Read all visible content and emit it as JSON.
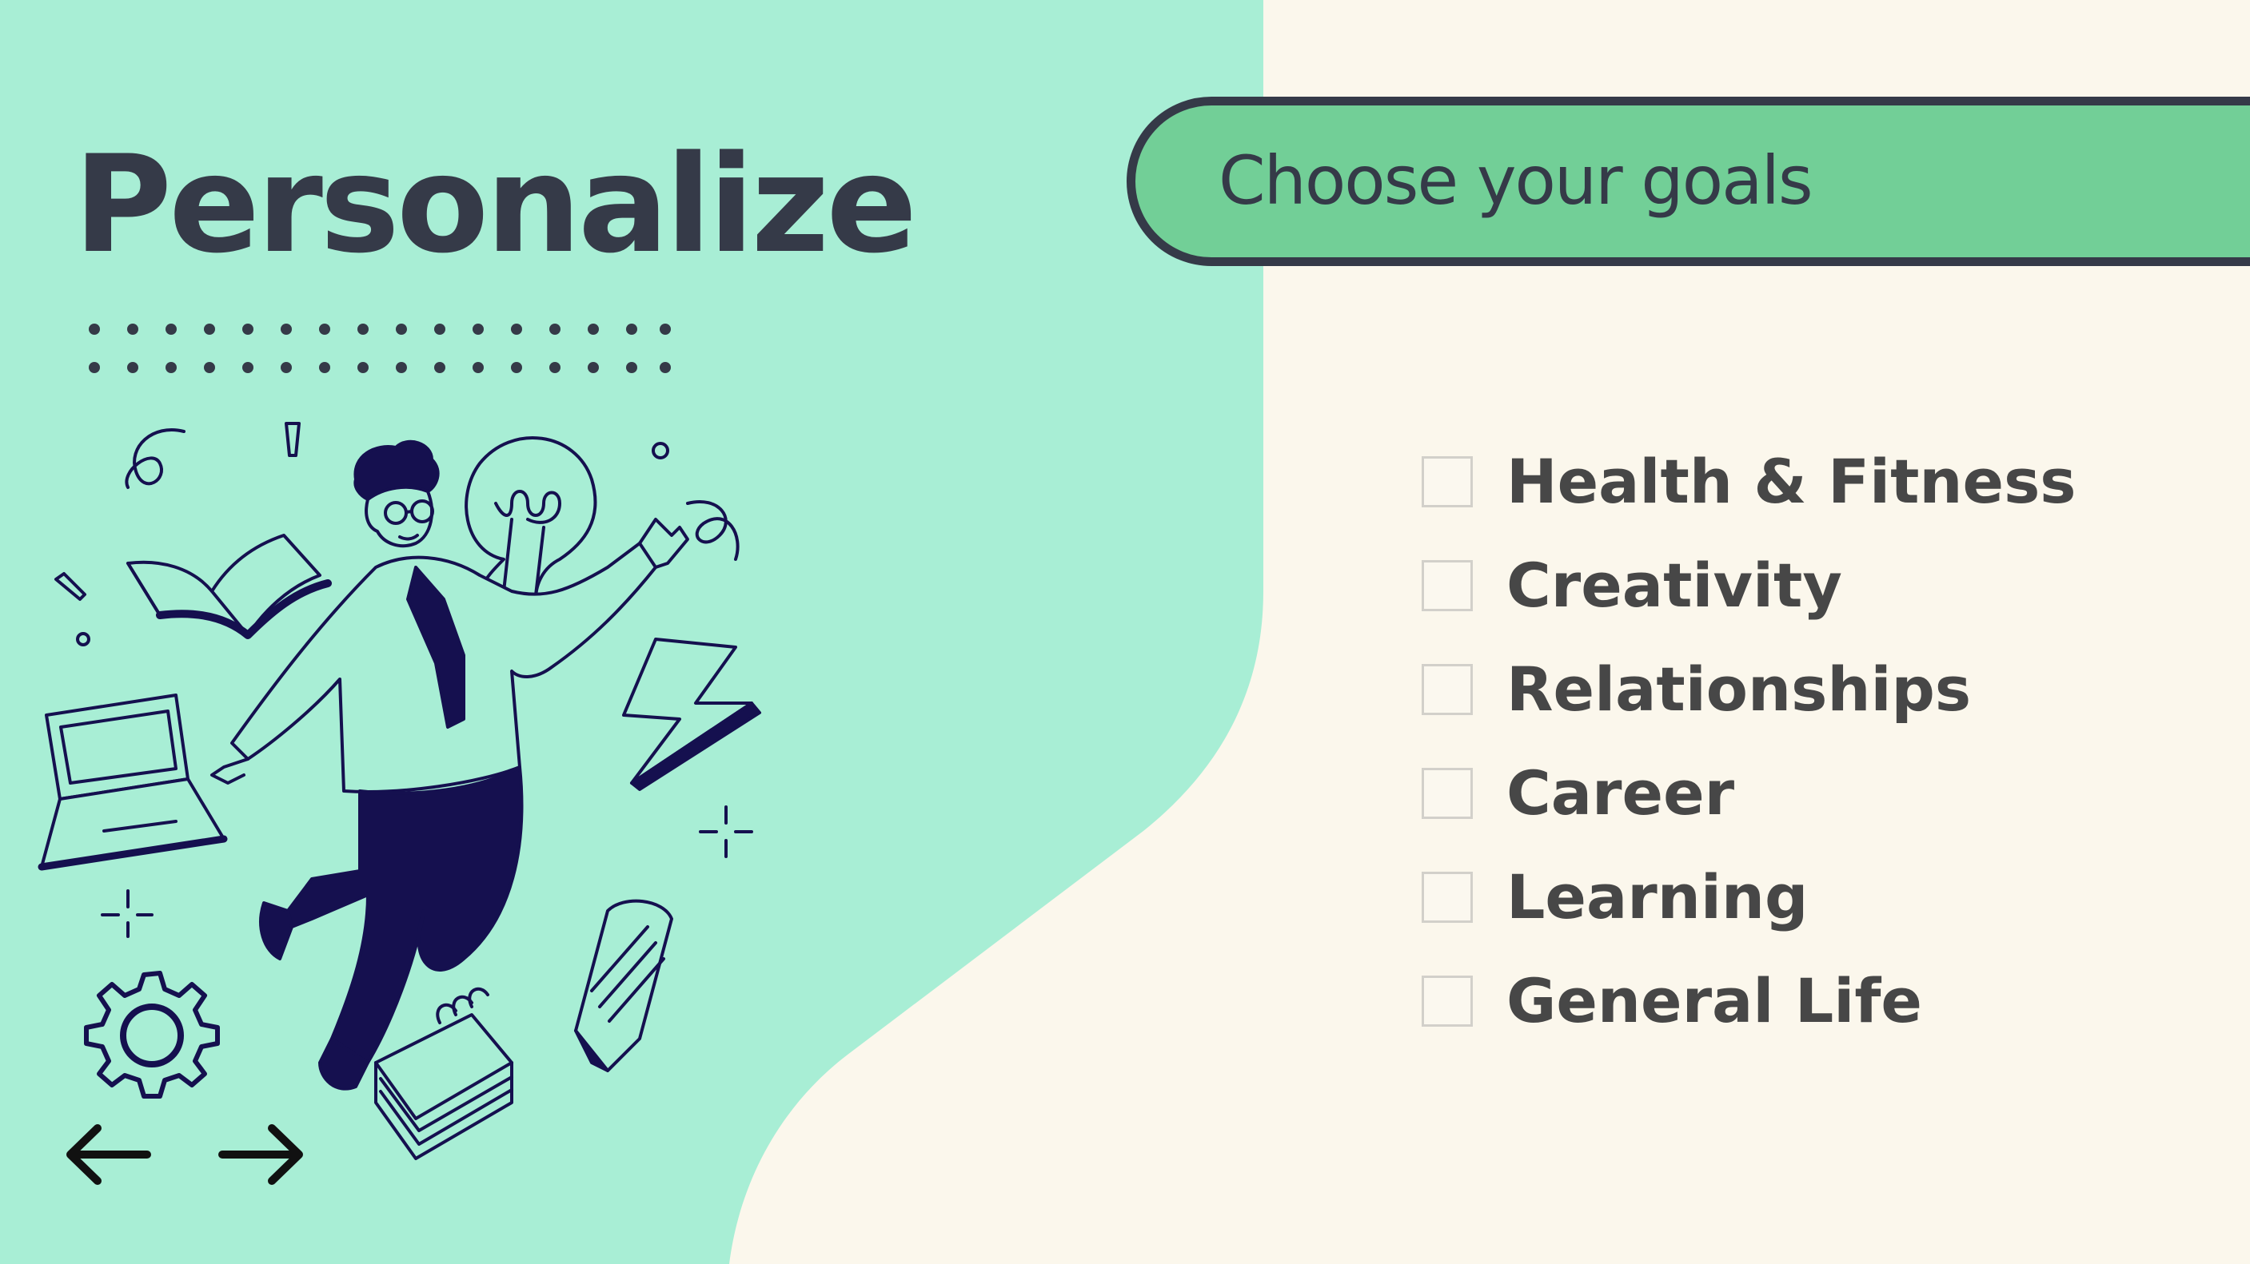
{
  "page": {
    "title": "Personalize"
  },
  "banner": {
    "title": "Choose your goals"
  },
  "goals": {
    "items": [
      {
        "label": "Health & Fitness",
        "checked": false
      },
      {
        "label": "Creativity",
        "checked": false
      },
      {
        "label": "Relationships",
        "checked": false
      },
      {
        "label": "Career",
        "checked": false
      },
      {
        "label": "Learning",
        "checked": false
      },
      {
        "label": "General Life",
        "checked": false
      }
    ]
  },
  "navigation": {
    "prev_icon": "arrow-left-icon",
    "next_icon": "arrow-right-icon"
  },
  "colors": {
    "mint_background": "#a8eed5",
    "cream_background": "#fbf7ec",
    "banner_green": "#72cf97",
    "dark_text": "#353a48",
    "navy_illustration": "#15104f"
  },
  "illustration": {
    "icons": [
      "person-icon",
      "lightbulb-icon",
      "book-icon",
      "laptop-icon",
      "lightning-icon",
      "pencil-icon",
      "gear-icon",
      "notepad-icon",
      "sparkle-icon"
    ]
  }
}
